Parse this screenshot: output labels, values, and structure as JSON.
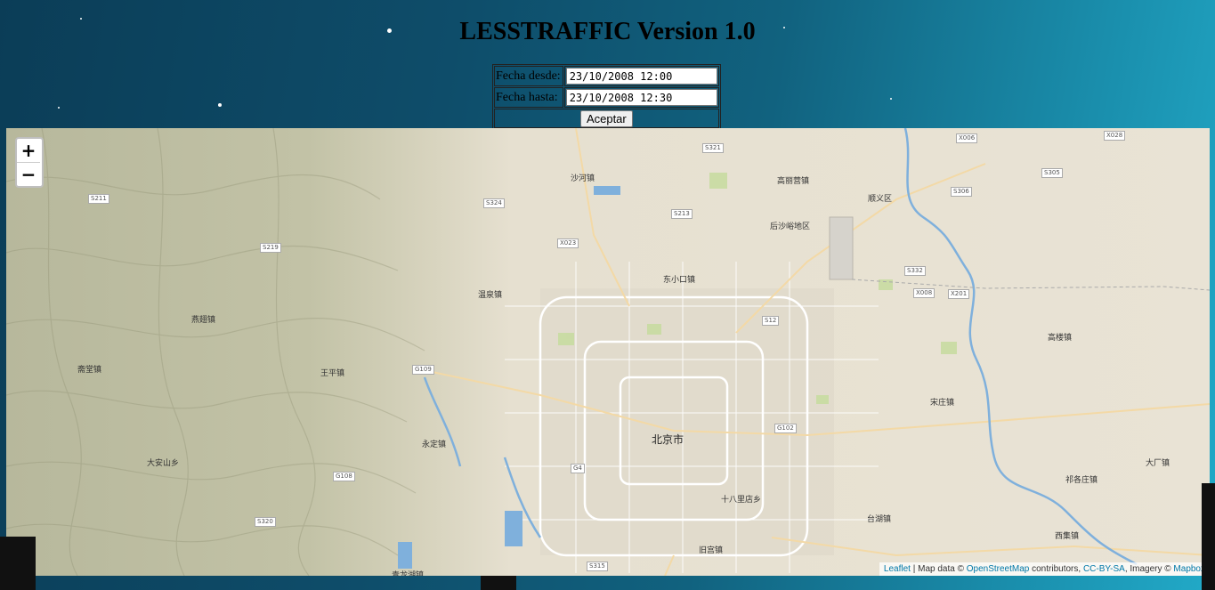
{
  "page": {
    "title": "LESSTRAFFIC Version 1.0"
  },
  "form": {
    "date_from_label": "Fecha desde:",
    "date_from_value": "23/10/2008 12:00",
    "date_to_label": "Fecha hasta:",
    "date_to_value": "23/10/2008 12:30",
    "accept_label": "Aceptar"
  },
  "map": {
    "zoom_in": "+",
    "zoom_out": "−",
    "city_label": "北京市",
    "place_labels": [
      "沙河镇",
      "高丽营镇",
      "顺义区",
      "后沙峪地区",
      "东小口镇",
      "温泉镇",
      "燕翅镇",
      "王平镇",
      "斋堂镇",
      "高楼镇",
      "宋庄镇",
      "永定镇",
      "大安山乡",
      "十八里店乡",
      "台湖镇",
      "大厂镇",
      "祁各庄镇",
      "西集镇",
      "旧宫镇",
      "青龙湖镇"
    ],
    "road_labels": [
      "S321",
      "X006",
      "X028",
      "S305",
      "S306",
      "S211",
      "S219",
      "S324",
      "S213",
      "X023",
      "S332",
      "X008",
      "X201",
      "S12",
      "G109",
      "G102",
      "G4",
      "G108",
      "S320",
      "S315"
    ],
    "attribution": {
      "leaflet": "Leaflet",
      "map_data": " | Map data © ",
      "osm": "OpenStreetMap",
      "contributors": " contributors, ",
      "license": "CC-BY-SA",
      "imagery": ", Imagery © ",
      "mapbox": "Mapbox"
    }
  }
}
